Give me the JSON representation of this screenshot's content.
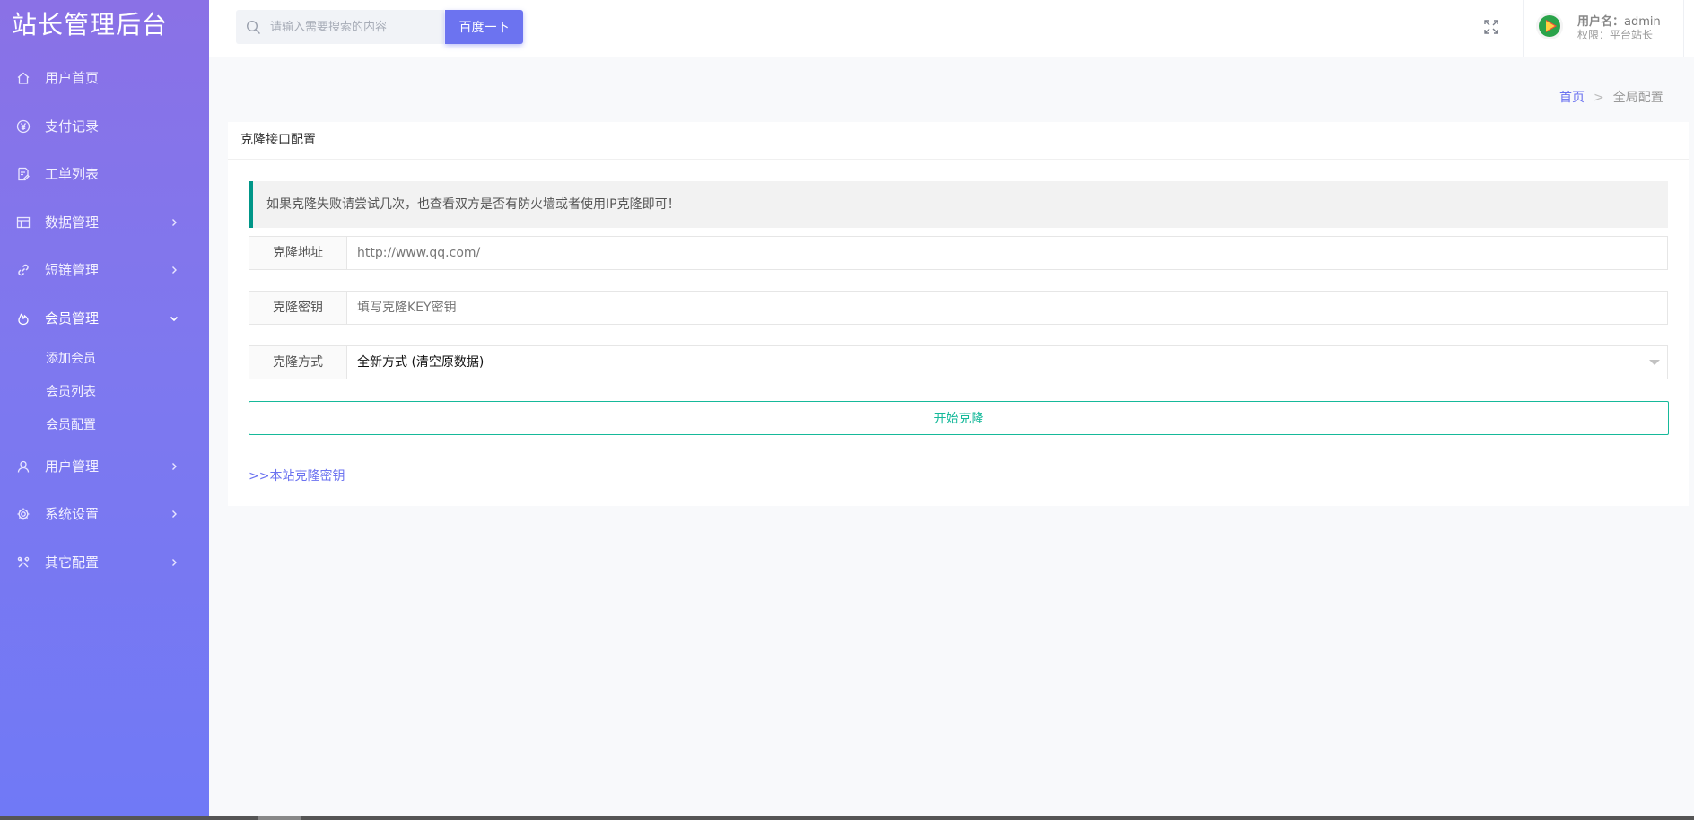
{
  "sidebar": {
    "brand": "站长管理后台",
    "items": [
      {
        "label": "用户首页",
        "icon": "home-icon"
      },
      {
        "label": "支付记录",
        "icon": "yen-icon"
      },
      {
        "label": "工单列表",
        "icon": "ticket-icon"
      },
      {
        "label": "数据管理",
        "icon": "table-icon"
      },
      {
        "label": "短链管理",
        "icon": "link-icon"
      },
      {
        "label": "会员管理",
        "icon": "fire-icon"
      },
      {
        "label": "用户管理",
        "icon": "user-icon"
      },
      {
        "label": "系统设置",
        "icon": "gear-icon"
      },
      {
        "label": "其它配置",
        "icon": "tools-icon"
      }
    ],
    "submenu": [
      "添加会员",
      "会员列表",
      "会员配置"
    ]
  },
  "header": {
    "search_placeholder": "请输入需要搜索的内容",
    "search_button": "百度一下",
    "user_label": "用户名：",
    "user_name": "admin",
    "role": "权限：平台站长"
  },
  "breadcrumb": {
    "home": "首页",
    "current": "全局配置"
  },
  "card": {
    "title": "克隆接口配置",
    "notice": "如果克隆失败请尝试几次，也查看双方是否有防火墙或者使用IP克隆即可！",
    "fields": {
      "url_label": "克隆地址",
      "url_placeholder": "http://www.qq.com/",
      "key_label": "克隆密钥",
      "key_placeholder": "填写克隆KEY密钥",
      "mode_label": "克隆方式",
      "mode_value": "全新方式 (清空原数据)"
    },
    "start_button": "开始克隆",
    "key_link": ">>本站克隆密钥"
  },
  "colors": {
    "sidebar_top": "#8a71e6",
    "sidebar_bottom": "#7079f6",
    "accent": "#6c73f0",
    "success": "#16b99a",
    "alert_border": "#009688"
  }
}
